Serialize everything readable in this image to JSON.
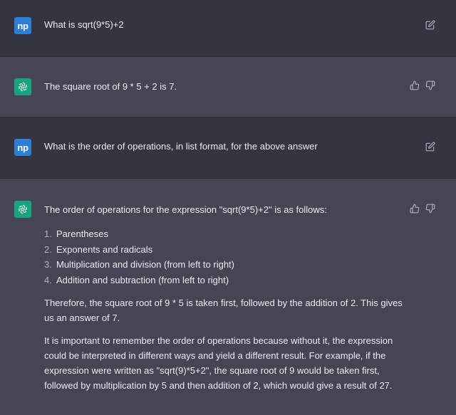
{
  "user_avatar_text": "np",
  "messages": [
    {
      "role": "user",
      "text": "What is sqrt(9*5)+2"
    },
    {
      "role": "assistant",
      "text": "The square root of 9 * 5 + 2 is 7."
    },
    {
      "role": "user",
      "text": "What is the order of operations, in list format, for the above answer"
    },
    {
      "role": "assistant",
      "intro": "The order of operations for the expression \"sqrt(9*5)+2\" is as follows:",
      "list": [
        {
          "num": "1.",
          "text": "Parentheses"
        },
        {
          "num": "2.",
          "text": "Exponents and radicals"
        },
        {
          "num": "3.",
          "text": "Multiplication and division (from left to right)"
        },
        {
          "num": "4.",
          "text": "Addition and subtraction (from left to right)"
        }
      ],
      "para1": "Therefore, the square root of 9 * 5 is taken first, followed by the addition of 2. This gives us an answer of 7.",
      "para2": "It is important to remember the order of operations because without it, the expression could be interpreted in different ways and yield a different result. For example, if the expression were written as \"sqrt(9)*5+2\", the square root of 9 would be taken first, followed by multiplication by 5 and then addition of 2, which would give a result of 27."
    }
  ],
  "icons": {
    "edit": "edit-icon",
    "thumbs_up": "thumbs-up-icon",
    "thumbs_down": "thumbs-down-icon",
    "assistant_logo": "openai-logo-icon"
  },
  "colors": {
    "user_bg": "#343541",
    "assistant_bg": "#444654",
    "user_avatar": "#2d7fd6",
    "assistant_avatar": "#19a37f",
    "text": "#ececf1",
    "icon": "#acacbe"
  }
}
